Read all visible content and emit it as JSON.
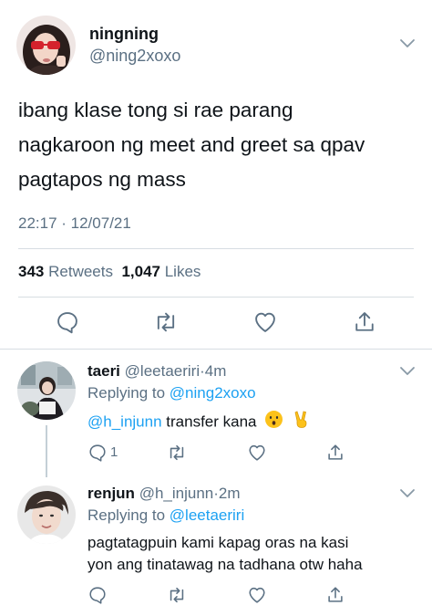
{
  "main_tweet": {
    "display_name": "ningning",
    "handle": "@ning2xoxo",
    "text_lines": [
      "ibang klase tong si rae parang",
      "nagkaroon ng meet and greet sa qpav",
      "pagtapos ng mass"
    ],
    "timestamp": "22:17 · 12/07/21",
    "retweet_count": "343",
    "retweet_label": "Retweets",
    "like_count": "1,047",
    "like_label": "Likes"
  },
  "replies": [
    {
      "display_name": "taeri",
      "handle": "@leetaeriri",
      "separator": "·",
      "time": "4m",
      "replying_prefix": "Replying to",
      "replying_to": "@ning2xoxo",
      "mention": "@h_injunn",
      "text": "transfer kana",
      "emojis": [
        "kissing-face-emoji",
        "victory-hand-emoji"
      ],
      "reply_count": "1"
    },
    {
      "display_name": "renjun",
      "handle": "@h_injunn",
      "separator": "·",
      "time": "2m",
      "replying_prefix": "Replying to",
      "replying_to": "@leetaeriri",
      "text_lines": [
        "pagtatagpuin kami kapag oras na kasi",
        "yon ang tinatawag na tadhana otw haha"
      ]
    }
  ],
  "icons": {
    "reply": "reply-icon",
    "retweet": "retweet-icon",
    "like": "like-icon",
    "share": "share-icon",
    "more": "chevron-down-icon"
  },
  "colors": {
    "link": "#1da1f2",
    "secondary_text": "#5b7083",
    "divider": "#d7dde2"
  }
}
